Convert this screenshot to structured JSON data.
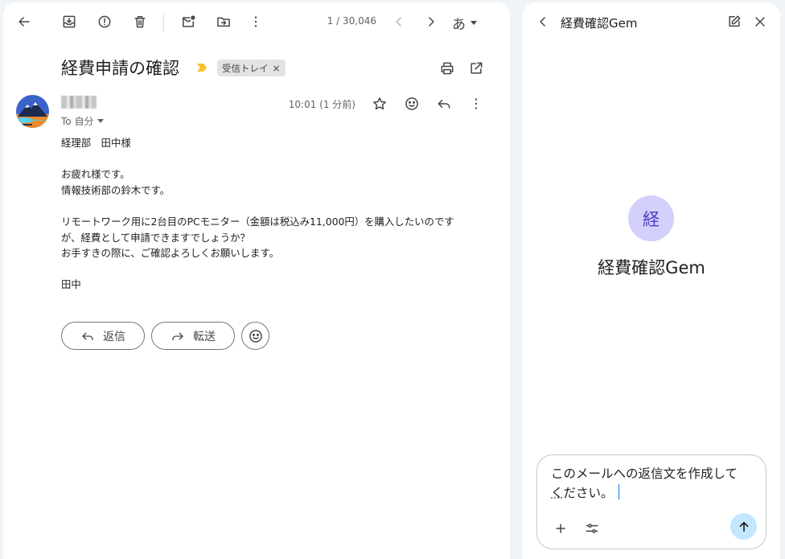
{
  "toolbar": {
    "pager": "1 / 30,046",
    "input_mode": "あ"
  },
  "email": {
    "subject": "経費申請の確認",
    "label_chip": "受信トレイ",
    "label_remove": "×",
    "to_label": "To 自分",
    "time": "10:01 (1 分前)",
    "body_lines": [
      "経理部　田中様",
      "",
      "お疲れ様です。",
      "情報技術部の鈴木です。",
      "",
      "リモートワーク用に2台目のPCモニター（金額は税込み11,000円）を購入したいのです",
      "が、経費として申請できますでしょうか？",
      "お手すきの際に、ご確認よろしくお願いします。",
      "",
      "田中"
    ],
    "reply_label": "返信",
    "forward_label": "転送"
  },
  "gem": {
    "header_title": "経費確認Gem",
    "avatar_initial": "経",
    "name": "経費確認Gem",
    "prompt_line1": "このメールへの返信文を作成して",
    "prompt_line2_underlined": "く",
    "prompt_line2_rest": "ださい。"
  },
  "colors": {
    "page_bg": "#f0f4f9",
    "importance_marker": "#f6c026",
    "gem_avatar_bg": "#d3d0fb",
    "gem_avatar_text": "#4b3fc6",
    "send_button_bg": "#c2e7ff"
  },
  "icons": {
    "toolbar": [
      "arrow-left-icon",
      "archive-icon",
      "report-spam-icon",
      "trash-icon",
      "mark-unread-icon",
      "move-to-icon",
      "more-vert-icon",
      "chevron-left-icon",
      "chevron-right-icon"
    ],
    "header": [
      "print-icon",
      "open-in-new-icon"
    ],
    "message": [
      "star-icon",
      "emoji-icon",
      "reply-icon",
      "more-vert-icon"
    ],
    "gem": [
      "chevron-left-icon",
      "edit-icon",
      "close-icon",
      "plus-icon",
      "tune-icon",
      "arrow-up-icon"
    ]
  }
}
